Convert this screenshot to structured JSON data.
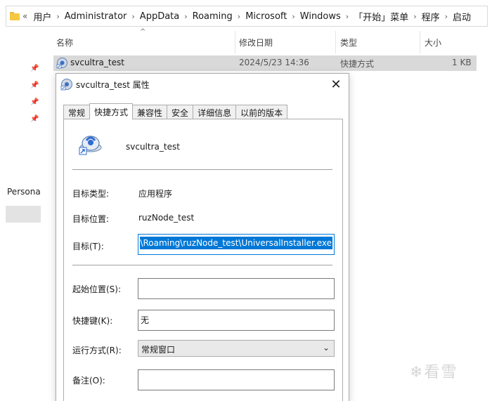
{
  "explorer": {
    "breadcrumb": [
      "用户",
      "Administrator",
      "AppData",
      "Roaming",
      "Microsoft",
      "Windows",
      "「开始」菜单",
      "程序",
      "启动"
    ],
    "columns": {
      "name": "名称",
      "date": "修改日期",
      "type": "类型",
      "size": "大小"
    },
    "files": [
      {
        "name": "svcultra_test",
        "date": "2024/5/23 14:36",
        "type": "快捷方式",
        "size": "1 KB"
      }
    ],
    "nav": {
      "partial_item": "Persona"
    }
  },
  "dialog": {
    "title": "svcultra_test 属性",
    "close_glyph": "✕",
    "tabs": [
      "常规",
      "快捷方式",
      "兼容性",
      "安全",
      "详细信息",
      "以前的版本"
    ],
    "active_tab": "快捷方式",
    "app_name": "svcultra_test",
    "target_type_label": "目标类型:",
    "target_type_value": "应用程序",
    "target_location_label": "目标位置:",
    "target_location_value": "ruzNode_test",
    "target_label": "目标(T):",
    "target_value": "a\\Roaming\\ruzNode_test\\UniversalInstaller.exe",
    "start_in_label": "起始位置(S):",
    "start_in_value": "",
    "shortcut_key_label": "快捷键(K):",
    "shortcut_key_value": "无",
    "run_label": "运行方式(R):",
    "run_value": "常规窗口",
    "comment_label": "备注(O):",
    "comment_value": ""
  },
  "watermark": "❄看雪"
}
